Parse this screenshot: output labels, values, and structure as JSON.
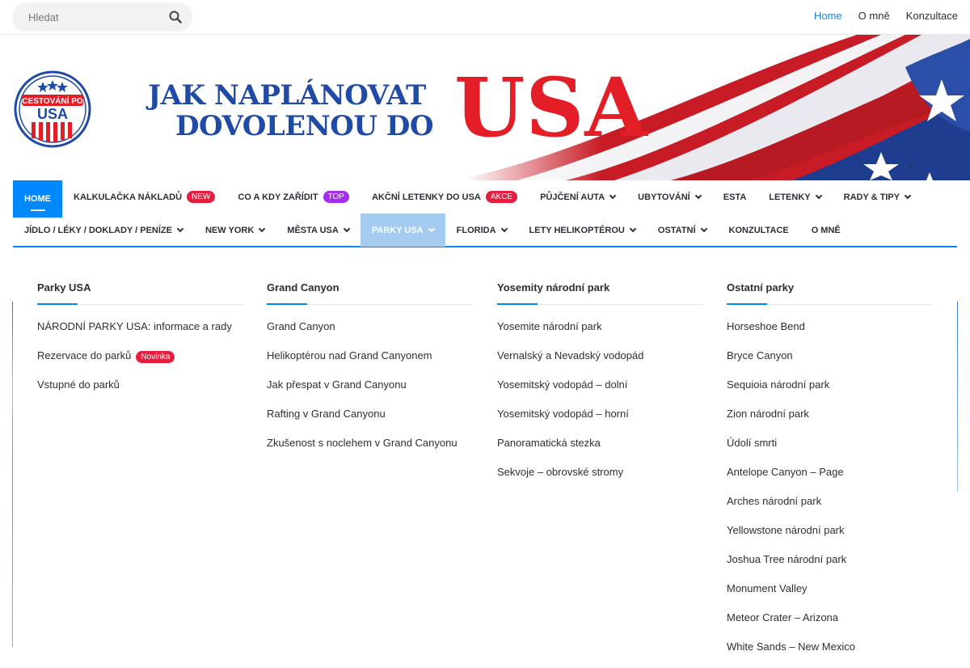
{
  "search": {
    "placeholder": "Hledat",
    "icon": "search-icon"
  },
  "topnav": [
    {
      "label": "Home",
      "active": true
    },
    {
      "label": "O mně"
    },
    {
      "label": "Konzultace"
    }
  ],
  "banner": {
    "logo_text": [
      "CESTOVÁNÍ PO",
      "USA"
    ],
    "headline_line1": "JAK NAPLÁNOVAT",
    "headline_line2": "DOVOLENOU DO",
    "headline_usa": "USA"
  },
  "mainnav": {
    "row1": [
      {
        "label": "Home",
        "active": true
      },
      {
        "label": "Kalkulačka nákladů",
        "badge": "NEW",
        "badge_color": "#e41e3f"
      },
      {
        "label": "Co a kdy zařídit",
        "badge": "TOP",
        "badge_color": "#a32eef"
      },
      {
        "label": "Akční letenky do USA",
        "badge": "AKCE",
        "badge_color": "#e41e3f"
      },
      {
        "label": "Půjčení auta",
        "dropdown": true
      },
      {
        "label": "Ubytování",
        "dropdown": true
      },
      {
        "label": "ESTA"
      },
      {
        "label": "Letenky",
        "dropdown": true
      },
      {
        "label": "Rady & tipy",
        "dropdown": true
      }
    ],
    "row2": [
      {
        "label": "Jídlo / Léky / Doklady / Peníze",
        "dropdown": true
      },
      {
        "label": "New York",
        "dropdown": true
      },
      {
        "label": "Města USA",
        "dropdown": true
      },
      {
        "label": "Parky USA",
        "dropdown": true,
        "highlight": true
      },
      {
        "label": "Florida",
        "dropdown": true
      },
      {
        "label": "Lety helikoptérou",
        "dropdown": true
      },
      {
        "label": "Ostatní",
        "dropdown": true
      },
      {
        "label": "Konzultace"
      },
      {
        "label": "O mně"
      }
    ]
  },
  "mega": {
    "columns": [
      {
        "title": "Parky USA",
        "items": [
          {
            "label": "NÁRODNÍ PARKY USA: informace a rady"
          },
          {
            "label": "Rezervace do parků",
            "badge": "Novinka"
          },
          {
            "label": "Vstupné do parků"
          }
        ]
      },
      {
        "title": "Grand Canyon",
        "items": [
          {
            "label": "Grand Canyon"
          },
          {
            "label": "Helikoptérou nad Grand Canyonem"
          },
          {
            "label": "Jak přespat v Grand Canyonu"
          },
          {
            "label": "Rafting v Grand Canyonu"
          },
          {
            "label": "Zkušenost s noclehem v Grand Canyonu"
          }
        ]
      },
      {
        "title": "Yosemity národní park",
        "items": [
          {
            "label": "Yosemite národní park"
          },
          {
            "label": "Vernalský a Nevadský vodopád"
          },
          {
            "label": "Yosemitský vodopád – dolní"
          },
          {
            "label": "Yosemitský vodopád – horní"
          },
          {
            "label": "Panoramatická stezka"
          },
          {
            "label": "Sekvoje – obrovské stromy"
          }
        ]
      },
      {
        "title": "Ostatní parky",
        "items": [
          {
            "label": "Horseshoe Bend"
          },
          {
            "label": "Bryce Canyon"
          },
          {
            "label": "Sequioia národní park"
          },
          {
            "label": "Zion národní park"
          },
          {
            "label": "Údolí smrti"
          },
          {
            "label": "Antelope Canyon – Page"
          },
          {
            "label": "Arches národní park"
          },
          {
            "label": "Yellowstone národní park"
          },
          {
            "label": "Joshua Tree národní park"
          },
          {
            "label": "Monument Valley"
          },
          {
            "label": "Meteor Crater – Arizona"
          },
          {
            "label": "White Sands – New Mexico"
          }
        ]
      }
    ]
  },
  "colors": {
    "accent": "#0088ff",
    "red": "#e41e26",
    "headline_blue": "#1f4aa6"
  }
}
